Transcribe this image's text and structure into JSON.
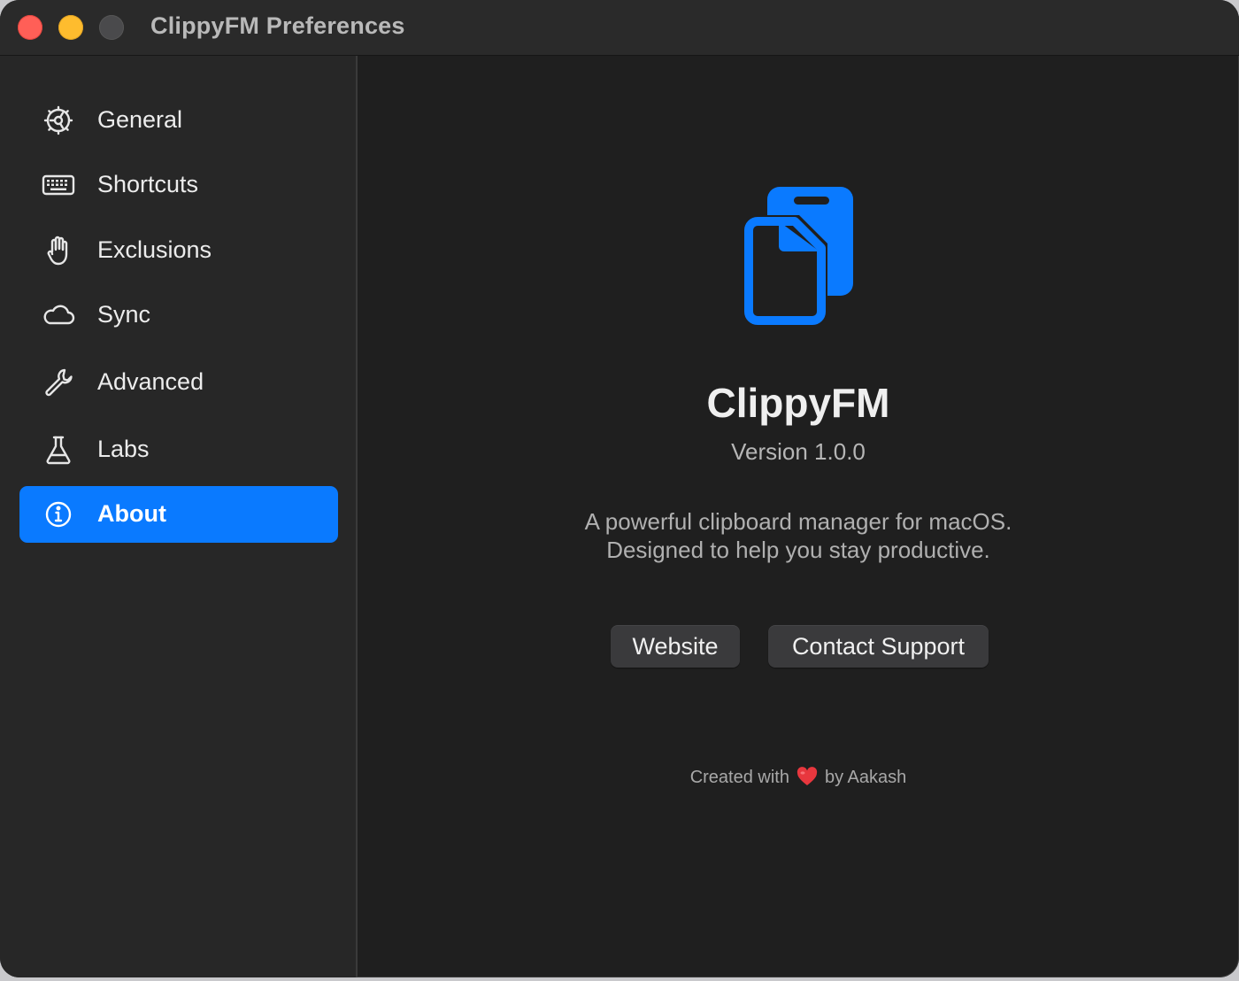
{
  "window": {
    "title": "ClippyFM Preferences"
  },
  "sidebar": {
    "items": [
      {
        "label": "General",
        "icon": "gear-icon",
        "active": false
      },
      {
        "label": "Shortcuts",
        "icon": "keyboard-icon",
        "active": false
      },
      {
        "label": "Exclusions",
        "icon": "hand-icon",
        "active": false
      },
      {
        "label": "Sync",
        "icon": "cloud-icon",
        "active": false
      },
      {
        "label": "Advanced",
        "icon": "wrench-icon",
        "active": false
      },
      {
        "label": "Labs",
        "icon": "flask-icon",
        "active": false
      },
      {
        "label": "About",
        "icon": "info-icon",
        "active": true
      }
    ]
  },
  "about": {
    "app_name": "ClippyFM",
    "version": "Version 1.0.0",
    "description_line1": "A powerful clipboard manager for macOS.",
    "description_line2": "Designed to help you stay productive.",
    "website_button": "Website",
    "support_button": "Contact Support",
    "credit_prefix": "Created with",
    "credit_suffix": "by Aakash",
    "logo_icon": "clipboard-docs-icon"
  },
  "colors": {
    "accent": "#0a7aff",
    "window_bg": "#1f1f1f",
    "sidebar_bg": "#272727",
    "heart": "#e8373e"
  }
}
